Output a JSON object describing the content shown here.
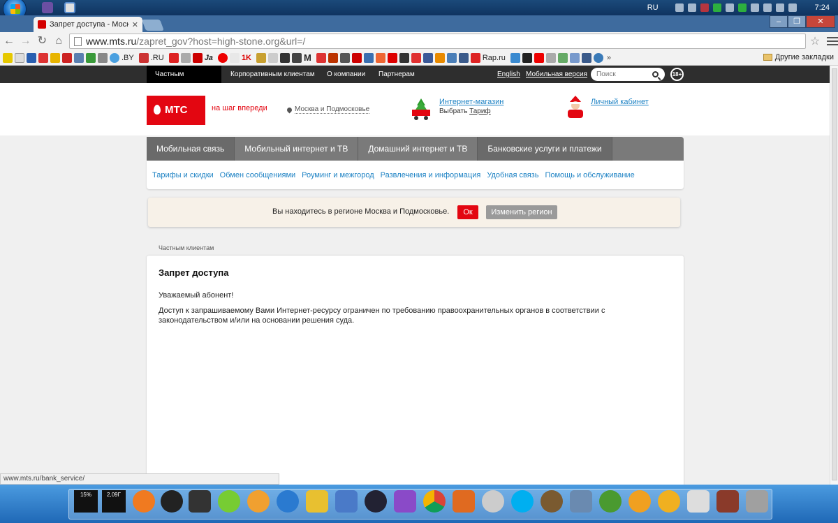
{
  "taskbar": {
    "language": "RU",
    "clock": "7:24"
  },
  "browser": {
    "tab_title": "Запрет доступа - Москва",
    "url_host": "www.mts.ru",
    "url_rest": "/zapret_gov?host=high-stone.org&url=/",
    "bookmarks": [
      ".BY",
      ".RU",
      "Ja",
      "1K",
      "M",
      "Rap.ru"
    ],
    "other_bookmarks": "Другие закладки",
    "status_url": "www.mts.ru/bank_service/"
  },
  "topnav": {
    "items": [
      "Частным клиентам",
      "Корпоративным клиентам",
      "О компании",
      "Партнерам"
    ],
    "english": "English",
    "mobile_version": "Мобильная версия",
    "search_placeholder": "Поиск",
    "age_badge": "18+"
  },
  "header": {
    "logo_text": "МТС",
    "slogan": "на шаг впереди",
    "region": "Москва и Подмосковье",
    "shop_link": "Интернет-магазин",
    "shop_sub_prefix": "Выбрать",
    "shop_sub_link": "Тариф",
    "cabinet_link": "Личный кабинет"
  },
  "main_menu": [
    "Мобильная связь",
    "Мобильный интернет и ТВ",
    "Домашний интернет и ТВ",
    "Банковские услуги и платежи"
  ],
  "sub_menu": [
    "Тарифы и скидки",
    "Обмен сообщениями",
    "Роуминг и межгород",
    "Развлечения и информация",
    "Удобная связь",
    "Помощь и обслуживание"
  ],
  "region_bar": {
    "message": "Вы находитесь в регионе Москва и Подмосковье.",
    "ok": "Ок",
    "change": "Изменить регион"
  },
  "breadcrumb": "Частным клиентам",
  "content": {
    "title": "Запрет доступа",
    "greeting": "Уважаемый абонент!",
    "body": "Доступ к запрашиваемому Вами Интернет-ресурсу ограничен по требованию правоохранительных органов в соответствии с законодательством и/или на основании решения суда."
  },
  "dock": {
    "gadget_cpu": "15%",
    "gadget_mem": "2,09Г"
  },
  "colors": {
    "mts_red": "#e30611",
    "link_blue": "#1d82c4"
  }
}
